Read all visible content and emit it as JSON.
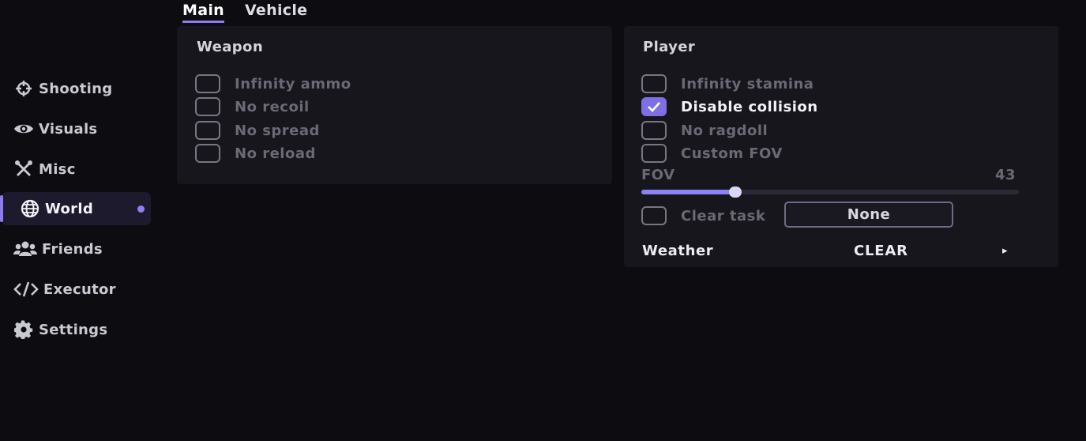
{
  "sidebar": {
    "items": [
      {
        "label": "Shooting",
        "icon": "crosshair-icon"
      },
      {
        "label": "Visuals",
        "icon": "eye-icon"
      },
      {
        "label": "Misc",
        "icon": "tools-icon"
      },
      {
        "label": "World",
        "icon": "globe-icon",
        "active": true
      },
      {
        "label": "Friends",
        "icon": "users-icon"
      },
      {
        "label": "Executor",
        "icon": "code-icon"
      },
      {
        "label": "Settings",
        "icon": "gear-icon"
      }
    ]
  },
  "tabs": [
    {
      "label": "Main",
      "active": true
    },
    {
      "label": "Vehicle"
    }
  ],
  "weapon": {
    "title": "Weapon",
    "options": [
      {
        "label": "Infinity ammo",
        "checked": false
      },
      {
        "label": "No recoil",
        "checked": false
      },
      {
        "label": "No spread",
        "checked": false
      },
      {
        "label": "No reload",
        "checked": false
      }
    ]
  },
  "player": {
    "title": "Player",
    "options": [
      {
        "label": "Infinity stamina",
        "checked": false
      },
      {
        "label": "Disable collision",
        "checked": true
      },
      {
        "label": "No ragdoll",
        "checked": false
      },
      {
        "label": "Custom FOV",
        "checked": false
      }
    ],
    "fov": {
      "label": "FOV",
      "value": "43",
      "fraction": 0.26
    },
    "clear_task": {
      "label": "Clear task",
      "checked": false,
      "button_label": "None"
    },
    "weather": {
      "label": "Weather",
      "value": "CLEAR",
      "arrow": "▸"
    }
  },
  "colors": {
    "accent": "#8c7cf0",
    "background": "#0d0c11",
    "panel": "#17161d"
  }
}
